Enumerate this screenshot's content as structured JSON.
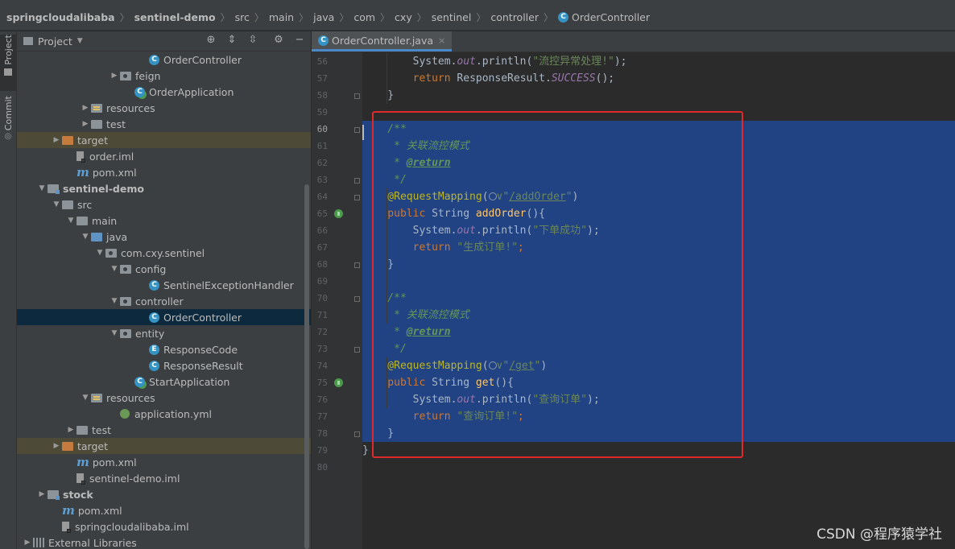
{
  "breadcrumb": [
    "springcloudalibaba",
    "sentinel-demo",
    "src",
    "main",
    "java",
    "com",
    "cxy",
    "sentinel",
    "controller",
    "OrderController"
  ],
  "project_panel": {
    "title": "Project",
    "tree": [
      {
        "label": "OrderController",
        "indent": 8,
        "icon": "class",
        "arrow": ""
      },
      {
        "label": "feign",
        "indent": 6,
        "icon": "package",
        "arrow": "right"
      },
      {
        "label": "OrderApplication",
        "indent": 7,
        "icon": "class-app",
        "arrow": ""
      },
      {
        "label": "resources",
        "indent": 4,
        "icon": "resources",
        "arrow": "right"
      },
      {
        "label": "test",
        "indent": 4,
        "icon": "folder",
        "arrow": "right"
      },
      {
        "label": "target",
        "indent": 2,
        "icon": "folder-orange",
        "arrow": "right",
        "excluded": true
      },
      {
        "label": "order.iml",
        "indent": 3,
        "icon": "iml",
        "arrow": ""
      },
      {
        "label": "pom.xml",
        "indent": 3,
        "icon": "maven",
        "arrow": ""
      },
      {
        "label": "sentinel-demo",
        "indent": 1,
        "icon": "module",
        "arrow": "down",
        "bold": true
      },
      {
        "label": "src",
        "indent": 2,
        "icon": "folder",
        "arrow": "down"
      },
      {
        "label": "main",
        "indent": 3,
        "icon": "folder",
        "arrow": "down"
      },
      {
        "label": "java",
        "indent": 4,
        "icon": "folder-blue",
        "arrow": "down"
      },
      {
        "label": "com.cxy.sentinel",
        "indent": 5,
        "icon": "package",
        "arrow": "down"
      },
      {
        "label": "config",
        "indent": 6,
        "icon": "package",
        "arrow": "down"
      },
      {
        "label": "SentinelExceptionHandler",
        "indent": 8,
        "icon": "class",
        "arrow": ""
      },
      {
        "label": "controller",
        "indent": 6,
        "icon": "package",
        "arrow": "down"
      },
      {
        "label": "OrderController",
        "indent": 8,
        "icon": "class",
        "arrow": "",
        "selected": true
      },
      {
        "label": "entity",
        "indent": 6,
        "icon": "package",
        "arrow": "down"
      },
      {
        "label": "ResponseCode",
        "indent": 8,
        "icon": "enum",
        "arrow": ""
      },
      {
        "label": "ResponseResult",
        "indent": 8,
        "icon": "class",
        "arrow": ""
      },
      {
        "label": "StartApplication",
        "indent": 7,
        "icon": "class-app",
        "arrow": ""
      },
      {
        "label": "resources",
        "indent": 4,
        "icon": "resources",
        "arrow": "down"
      },
      {
        "label": "application.yml",
        "indent": 6,
        "icon": "yml",
        "arrow": ""
      },
      {
        "label": "test",
        "indent": 3,
        "icon": "folder",
        "arrow": "right"
      },
      {
        "label": "target",
        "indent": 2,
        "icon": "folder-orange",
        "arrow": "right",
        "excluded": true
      },
      {
        "label": "pom.xml",
        "indent": 3,
        "icon": "maven",
        "arrow": ""
      },
      {
        "label": "sentinel-demo.iml",
        "indent": 3,
        "icon": "iml",
        "arrow": ""
      },
      {
        "label": "stock",
        "indent": 1,
        "icon": "module",
        "arrow": "right",
        "bold": true
      },
      {
        "label": "pom.xml",
        "indent": 2,
        "icon": "maven",
        "arrow": ""
      },
      {
        "label": "springcloudalibaba.iml",
        "indent": 2,
        "icon": "iml",
        "arrow": ""
      },
      {
        "label": "External Libraries",
        "indent": 0,
        "icon": "libraries",
        "arrow": "right"
      }
    ]
  },
  "side_strip": {
    "project_label": "Project",
    "commit_label": "Commit"
  },
  "editor": {
    "tab_label": "OrderController.java",
    "tab_close": "×",
    "lines": [
      {
        "n": 56,
        "t": [
          [
            "",
            "        System."
          ],
          [
            "itf",
            "out"
          ],
          [
            "",
            ".println("
          ],
          [
            "str",
            "\"流控异常处理!\""
          ],
          [
            "",
            ");"
          ]
        ]
      },
      {
        "n": 57,
        "t": [
          [
            "",
            "        "
          ],
          [
            "kw",
            "return "
          ],
          [
            "",
            "ResponseResult."
          ],
          [
            "itf",
            "SUCCESS"
          ],
          [
            "",
            "();"
          ]
        ]
      },
      {
        "n": 58,
        "t": [
          [
            "",
            "    }"
          ]
        ]
      },
      {
        "n": 59,
        "t": []
      },
      {
        "n": 60,
        "t": [
          [
            "cmt",
            "    /**"
          ]
        ]
      },
      {
        "n": 61,
        "t": [
          [
            "cmt",
            "     * 关联流控模式"
          ]
        ]
      },
      {
        "n": 62,
        "t": [
          [
            "cmt",
            "     * "
          ],
          [
            "tag",
            "@return"
          ]
        ]
      },
      {
        "n": 63,
        "t": [
          [
            "cmt",
            "     */"
          ]
        ]
      },
      {
        "n": 64,
        "t": [
          [
            "ann",
            "    @RequestMapping"
          ],
          [
            "",
            "("
          ],
          [
            "glob",
            ""
          ],
          [
            "str",
            "∨\""
          ],
          [
            "url",
            "/addOrder"
          ],
          [
            "str",
            "\""
          ],
          [
            "",
            ")"
          ]
        ]
      },
      {
        "n": 65,
        "t": [
          [
            "kw",
            "    public "
          ],
          [
            "",
            "String "
          ],
          [
            "fn",
            "addOrder"
          ],
          [
            "",
            "(){"
          ]
        ]
      },
      {
        "n": 66,
        "t": [
          [
            "",
            "        System."
          ],
          [
            "itf",
            "out"
          ],
          [
            "",
            ".println("
          ],
          [
            "str",
            "\"下单成功\""
          ],
          [
            "",
            ");"
          ]
        ]
      },
      {
        "n": 67,
        "t": [
          [
            "",
            "        "
          ],
          [
            "kw",
            "return "
          ],
          [
            "str",
            "\"生成订单!\""
          ],
          [
            "kw",
            ";"
          ]
        ]
      },
      {
        "n": 68,
        "t": [
          [
            "",
            "    }"
          ]
        ]
      },
      {
        "n": 69,
        "t": []
      },
      {
        "n": 70,
        "t": [
          [
            "cmt",
            "    /**"
          ]
        ]
      },
      {
        "n": 71,
        "t": [
          [
            "cmt",
            "     * 关联流控模式"
          ]
        ]
      },
      {
        "n": 72,
        "t": [
          [
            "cmt",
            "     * "
          ],
          [
            "tag",
            "@return"
          ]
        ]
      },
      {
        "n": 73,
        "t": [
          [
            "cmt",
            "     */"
          ]
        ]
      },
      {
        "n": 74,
        "t": [
          [
            "ann",
            "    @RequestMapping"
          ],
          [
            "",
            "("
          ],
          [
            "glob",
            ""
          ],
          [
            "str",
            "∨\""
          ],
          [
            "url",
            "/get"
          ],
          [
            "str",
            "\""
          ],
          [
            "",
            ")"
          ]
        ]
      },
      {
        "n": 75,
        "t": [
          [
            "kw",
            "    public "
          ],
          [
            "",
            "String "
          ],
          [
            "fn",
            "get"
          ],
          [
            "",
            "(){"
          ]
        ]
      },
      {
        "n": 76,
        "t": [
          [
            "",
            "        System."
          ],
          [
            "itf",
            "out"
          ],
          [
            "",
            ".println("
          ],
          [
            "str",
            "\"查询订单\""
          ],
          [
            "",
            ");"
          ]
        ]
      },
      {
        "n": 77,
        "t": [
          [
            "",
            "        "
          ],
          [
            "kw",
            "return "
          ],
          [
            "str",
            "\"查询订单!\""
          ],
          [
            "kw",
            ";"
          ]
        ]
      },
      {
        "n": 78,
        "t": [
          [
            "",
            "    }"
          ]
        ]
      },
      {
        "n": 79,
        "t": [
          [
            "",
            "}"
          ]
        ]
      },
      {
        "n": 80,
        "t": []
      }
    ]
  },
  "watermark": "CSDN @程序猿学社",
  "colors": {
    "selection": "#214283",
    "highlight_box": "#e0292b",
    "accent": "#4a88c7"
  }
}
